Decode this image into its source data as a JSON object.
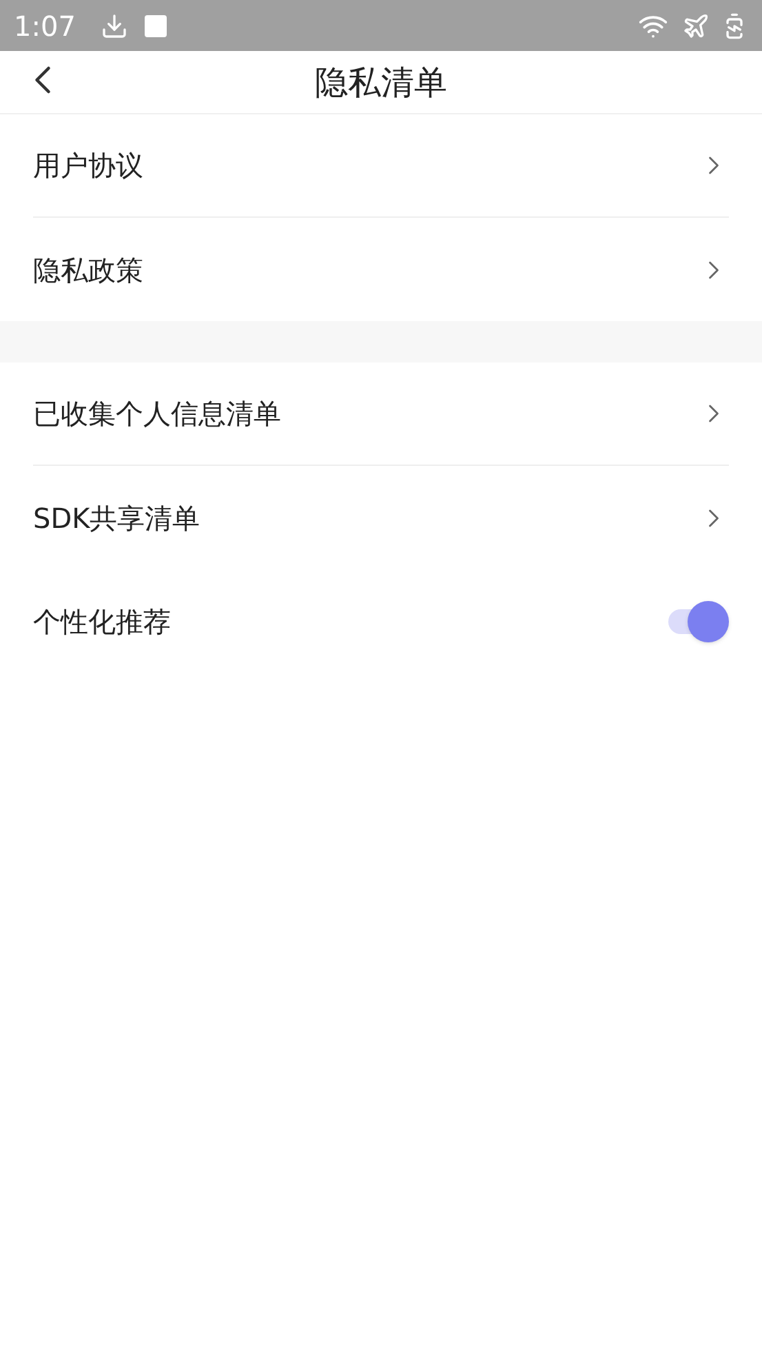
{
  "status_bar": {
    "time": "1:07"
  },
  "header": {
    "title": "隐私清单"
  },
  "sections": [
    {
      "items": [
        {
          "label": "用户协议",
          "kind": "link"
        },
        {
          "label": "隐私政策",
          "kind": "link"
        }
      ]
    },
    {
      "items": [
        {
          "label": "已收集个人信息清单",
          "kind": "link"
        },
        {
          "label": "SDK共享清单",
          "kind": "link"
        },
        {
          "label": "个性化推荐",
          "kind": "toggle",
          "on": true
        }
      ]
    }
  ]
}
